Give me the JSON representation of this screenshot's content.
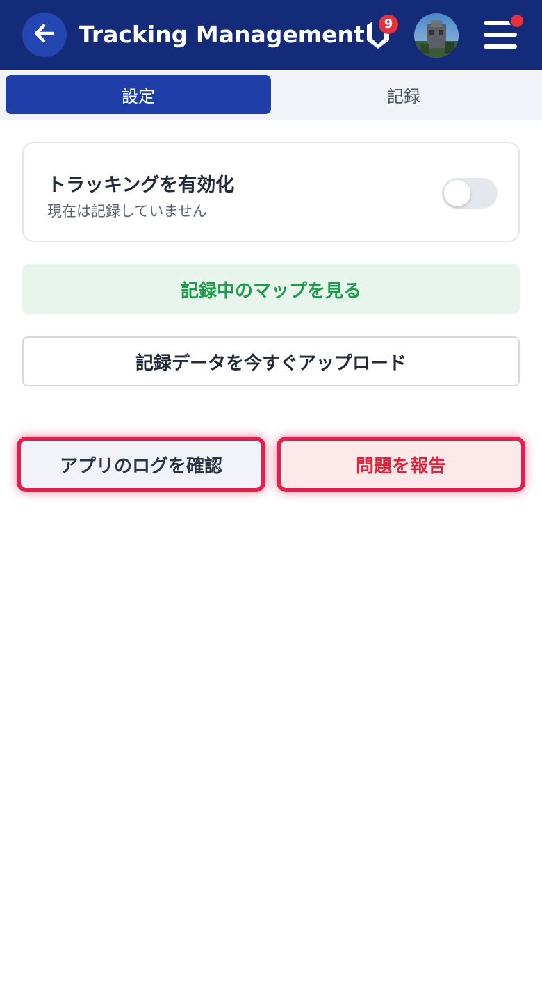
{
  "header": {
    "title": "Tracking Management",
    "back_icon": "arrow-left-icon",
    "brand_icon": "shield-logo-icon",
    "notification_count": "9",
    "avatar": "user-avatar",
    "menu_icon": "hamburger-menu-icon",
    "menu_has_indicator": true
  },
  "tabs": [
    {
      "label": "設定",
      "active": true
    },
    {
      "label": "記録",
      "active": false
    }
  ],
  "tracking_card": {
    "title": "トラッキングを有効化",
    "subtitle": "現在は記録していません",
    "toggle_on": false
  },
  "actions": {
    "map_label": "記録中のマップを見る",
    "upload_label": "記録データを今すぐアップロード",
    "logs_label": "アプリのログを確認",
    "report_label": "問題を報告"
  },
  "colors": {
    "header_bg": "#132b78",
    "accent": "#1f3ea8",
    "success": "#1f9c4a",
    "danger": "#e0204f",
    "badge": "#e5313d"
  }
}
